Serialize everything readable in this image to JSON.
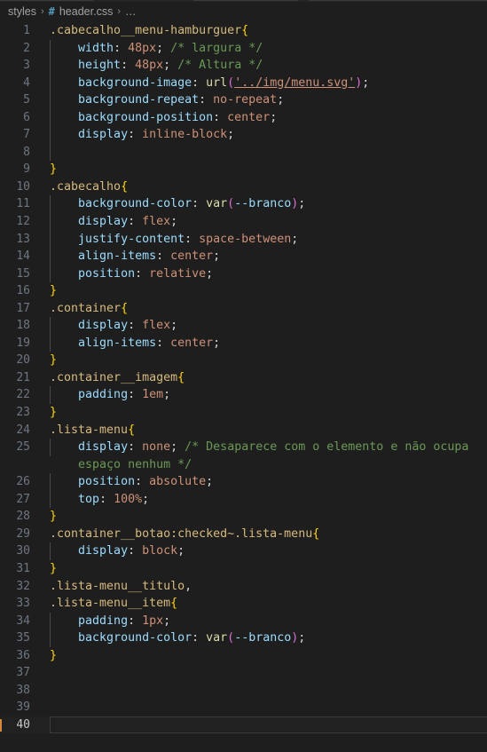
{
  "window": {
    "app": "code-editor",
    "theme": "dark-plus"
  },
  "breadcrumb": {
    "name": "breadcrumb",
    "folder": "styles",
    "separator": "›",
    "file_icon": "#",
    "file": "header.css",
    "ellipsis": "…"
  },
  "editor": {
    "language": "css",
    "total_lines": 40,
    "active_line": 40,
    "indent_size": 4,
    "colors": {
      "background": "#1e1e1e",
      "gutter_text": "#6e7681",
      "active_gutter_text": "#c8c8c8",
      "selector": "#d7ba7d",
      "brace": "#ffd700",
      "property": "#9cdcfe",
      "value": "#ce9178",
      "comment": "#6a9955",
      "function": "#dcdcaa",
      "paren": "#da70d6",
      "punctuation": "#d4d4d4",
      "active_line_border": "#3b3b3b",
      "indent_guide": "#484848",
      "cursor_marker": "#d7883e"
    },
    "lines": [
      {
        "n": 1,
        "indent": 0,
        "guide": false,
        "tokens": [
          {
            "c": "t-sel",
            "t": ".cabecalho__menu-hamburguer"
          },
          {
            "c": "t-brace",
            "t": "{"
          }
        ]
      },
      {
        "n": 2,
        "indent": 1,
        "guide": true,
        "tokens": [
          {
            "c": "t-prop",
            "t": "width"
          },
          {
            "c": "t-punc",
            "t": ": "
          },
          {
            "c": "t-val",
            "t": "48px"
          },
          {
            "c": "t-punc",
            "t": ";"
          },
          {
            "c": "t-punc",
            "t": " "
          },
          {
            "c": "t-com",
            "t": "/* largura */"
          }
        ]
      },
      {
        "n": 3,
        "indent": 1,
        "guide": true,
        "tokens": [
          {
            "c": "t-prop",
            "t": "height"
          },
          {
            "c": "t-punc",
            "t": ": "
          },
          {
            "c": "t-val",
            "t": "48px"
          },
          {
            "c": "t-punc",
            "t": ";"
          },
          {
            "c": "t-punc",
            "t": " "
          },
          {
            "c": "t-com",
            "t": "/* Altura */"
          }
        ]
      },
      {
        "n": 4,
        "indent": 1,
        "guide": true,
        "tokens": [
          {
            "c": "t-prop",
            "t": "background-image"
          },
          {
            "c": "t-punc",
            "t": ": "
          },
          {
            "c": "t-fn",
            "t": "url"
          },
          {
            "c": "t-paren",
            "t": "("
          },
          {
            "c": "t-link",
            "t": "'../img/menu.svg'"
          },
          {
            "c": "t-paren",
            "t": ")"
          },
          {
            "c": "t-punc",
            "t": ";"
          }
        ]
      },
      {
        "n": 5,
        "indent": 1,
        "guide": true,
        "tokens": [
          {
            "c": "t-prop",
            "t": "background-repeat"
          },
          {
            "c": "t-punc",
            "t": ": "
          },
          {
            "c": "t-val",
            "t": "no-repeat"
          },
          {
            "c": "t-punc",
            "t": ";"
          }
        ]
      },
      {
        "n": 6,
        "indent": 1,
        "guide": true,
        "tokens": [
          {
            "c": "t-prop",
            "t": "background-position"
          },
          {
            "c": "t-punc",
            "t": ": "
          },
          {
            "c": "t-val",
            "t": "center"
          },
          {
            "c": "t-punc",
            "t": ";"
          }
        ]
      },
      {
        "n": 7,
        "indent": 1,
        "guide": true,
        "tokens": [
          {
            "c": "t-prop",
            "t": "display"
          },
          {
            "c": "t-punc",
            "t": ": "
          },
          {
            "c": "t-val",
            "t": "inline-block"
          },
          {
            "c": "t-punc",
            "t": ";"
          }
        ]
      },
      {
        "n": 8,
        "indent": 1,
        "guide": true,
        "tokens": []
      },
      {
        "n": 9,
        "indent": 0,
        "guide": false,
        "tokens": [
          {
            "c": "t-brace",
            "t": "}"
          }
        ]
      },
      {
        "n": 10,
        "indent": 0,
        "guide": false,
        "tokens": [
          {
            "c": "t-sel",
            "t": ".cabecalho"
          },
          {
            "c": "t-brace",
            "t": "{"
          }
        ]
      },
      {
        "n": 11,
        "indent": 1,
        "guide": true,
        "tokens": [
          {
            "c": "t-prop",
            "t": "background-color"
          },
          {
            "c": "t-punc",
            "t": ": "
          },
          {
            "c": "t-fn",
            "t": "var"
          },
          {
            "c": "t-paren",
            "t": "("
          },
          {
            "c": "t-var",
            "t": "--branco"
          },
          {
            "c": "t-paren",
            "t": ")"
          },
          {
            "c": "t-punc",
            "t": ";"
          }
        ]
      },
      {
        "n": 12,
        "indent": 1,
        "guide": true,
        "tokens": [
          {
            "c": "t-prop",
            "t": "display"
          },
          {
            "c": "t-punc",
            "t": ": "
          },
          {
            "c": "t-val",
            "t": "flex"
          },
          {
            "c": "t-punc",
            "t": ";"
          }
        ]
      },
      {
        "n": 13,
        "indent": 1,
        "guide": true,
        "tokens": [
          {
            "c": "t-prop",
            "t": "justify-content"
          },
          {
            "c": "t-punc",
            "t": ": "
          },
          {
            "c": "t-val",
            "t": "space-between"
          },
          {
            "c": "t-punc",
            "t": ";"
          }
        ]
      },
      {
        "n": 14,
        "indent": 1,
        "guide": true,
        "tokens": [
          {
            "c": "t-prop",
            "t": "align-items"
          },
          {
            "c": "t-punc",
            "t": ": "
          },
          {
            "c": "t-val",
            "t": "center"
          },
          {
            "c": "t-punc",
            "t": ";"
          }
        ]
      },
      {
        "n": 15,
        "indent": 1,
        "guide": true,
        "tokens": [
          {
            "c": "t-prop",
            "t": "position"
          },
          {
            "c": "t-punc",
            "t": ": "
          },
          {
            "c": "t-val",
            "t": "relative"
          },
          {
            "c": "t-punc",
            "t": ";"
          }
        ]
      },
      {
        "n": 16,
        "indent": 0,
        "guide": false,
        "tokens": [
          {
            "c": "t-brace",
            "t": "}"
          }
        ]
      },
      {
        "n": 17,
        "indent": 0,
        "guide": false,
        "tokens": [
          {
            "c": "t-sel",
            "t": ".container"
          },
          {
            "c": "t-brace",
            "t": "{"
          }
        ]
      },
      {
        "n": 18,
        "indent": 1,
        "guide": true,
        "tokens": [
          {
            "c": "t-prop",
            "t": "display"
          },
          {
            "c": "t-punc",
            "t": ": "
          },
          {
            "c": "t-val",
            "t": "flex"
          },
          {
            "c": "t-punc",
            "t": ";"
          }
        ]
      },
      {
        "n": 19,
        "indent": 1,
        "guide": true,
        "tokens": [
          {
            "c": "t-prop",
            "t": "align-items"
          },
          {
            "c": "t-punc",
            "t": ": "
          },
          {
            "c": "t-val",
            "t": "center"
          },
          {
            "c": "t-punc",
            "t": ";"
          }
        ]
      },
      {
        "n": 20,
        "indent": 0,
        "guide": false,
        "tokens": [
          {
            "c": "t-brace",
            "t": "}"
          }
        ]
      },
      {
        "n": 21,
        "indent": 0,
        "guide": false,
        "tokens": [
          {
            "c": "t-sel",
            "t": ".container__imagem"
          },
          {
            "c": "t-brace",
            "t": "{"
          }
        ]
      },
      {
        "n": 22,
        "indent": 1,
        "guide": true,
        "tokens": [
          {
            "c": "t-prop",
            "t": "padding"
          },
          {
            "c": "t-punc",
            "t": ": "
          },
          {
            "c": "t-val",
            "t": "1em"
          },
          {
            "c": "t-punc",
            "t": ";"
          }
        ]
      },
      {
        "n": 23,
        "indent": 0,
        "guide": false,
        "tokens": [
          {
            "c": "t-brace",
            "t": "}"
          }
        ]
      },
      {
        "n": 24,
        "indent": 0,
        "guide": false,
        "tokens": [
          {
            "c": "t-sel",
            "t": ".lista-menu"
          },
          {
            "c": "t-brace",
            "t": "{"
          }
        ]
      },
      {
        "n": 25,
        "indent": 1,
        "guide": true,
        "tokens": [
          {
            "c": "t-prop",
            "t": "display"
          },
          {
            "c": "t-punc",
            "t": ": "
          },
          {
            "c": "t-val",
            "t": "none"
          },
          {
            "c": "t-punc",
            "t": ";"
          },
          {
            "c": "t-punc",
            "t": " "
          },
          {
            "c": "t-com",
            "t": "/* Desaparece com o elemento e não ocupa"
          }
        ]
      },
      {
        "n": "",
        "indent": 1,
        "guide": false,
        "wrap": true,
        "tokens": [
          {
            "c": "t-com",
            "t": "espaço nenhum */"
          }
        ]
      },
      {
        "n": 26,
        "indent": 1,
        "guide": true,
        "tokens": [
          {
            "c": "t-prop",
            "t": "position"
          },
          {
            "c": "t-punc",
            "t": ": "
          },
          {
            "c": "t-val",
            "t": "absolute"
          },
          {
            "c": "t-punc",
            "t": ";"
          }
        ]
      },
      {
        "n": 27,
        "indent": 1,
        "guide": true,
        "tokens": [
          {
            "c": "t-prop",
            "t": "top"
          },
          {
            "c": "t-punc",
            "t": ": "
          },
          {
            "c": "t-val",
            "t": "100%"
          },
          {
            "c": "t-punc",
            "t": ";"
          }
        ]
      },
      {
        "n": 28,
        "indent": 0,
        "guide": false,
        "tokens": [
          {
            "c": "t-brace",
            "t": "}"
          }
        ]
      },
      {
        "n": 29,
        "indent": 0,
        "guide": false,
        "tokens": [
          {
            "c": "t-sel",
            "t": ".container__botao:checked~.lista-menu"
          },
          {
            "c": "t-brace",
            "t": "{"
          }
        ]
      },
      {
        "n": 30,
        "indent": 1,
        "guide": true,
        "tokens": [
          {
            "c": "t-prop",
            "t": "display"
          },
          {
            "c": "t-punc",
            "t": ": "
          },
          {
            "c": "t-val",
            "t": "block"
          },
          {
            "c": "t-punc",
            "t": ";"
          }
        ]
      },
      {
        "n": 31,
        "indent": 0,
        "guide": false,
        "tokens": [
          {
            "c": "t-brace",
            "t": "}"
          }
        ]
      },
      {
        "n": 32,
        "indent": 0,
        "guide": false,
        "tokens": [
          {
            "c": "t-sel",
            "t": ".lista-menu__titulo"
          },
          {
            "c": "t-punc",
            "t": ","
          }
        ]
      },
      {
        "n": 33,
        "indent": 0,
        "guide": false,
        "tokens": [
          {
            "c": "t-sel",
            "t": ".lista-menu__item"
          },
          {
            "c": "t-brace",
            "t": "{"
          }
        ]
      },
      {
        "n": 34,
        "indent": 1,
        "guide": true,
        "tokens": [
          {
            "c": "t-prop",
            "t": "padding"
          },
          {
            "c": "t-punc",
            "t": ": "
          },
          {
            "c": "t-val",
            "t": "1px"
          },
          {
            "c": "t-punc",
            "t": ";"
          }
        ]
      },
      {
        "n": 35,
        "indent": 1,
        "guide": true,
        "tokens": [
          {
            "c": "t-prop",
            "t": "background-color"
          },
          {
            "c": "t-punc",
            "t": ": "
          },
          {
            "c": "t-fn",
            "t": "var"
          },
          {
            "c": "t-paren",
            "t": "("
          },
          {
            "c": "t-var",
            "t": "--branco"
          },
          {
            "c": "t-paren",
            "t": ")"
          },
          {
            "c": "t-punc",
            "t": ";"
          }
        ]
      },
      {
        "n": 36,
        "indent": 0,
        "guide": false,
        "tokens": [
          {
            "c": "t-brace",
            "t": "}"
          }
        ]
      },
      {
        "n": 37,
        "indent": 0,
        "guide": false,
        "tokens": []
      },
      {
        "n": 38,
        "indent": 0,
        "guide": false,
        "tokens": []
      },
      {
        "n": 39,
        "indent": 0,
        "guide": false,
        "tokens": []
      },
      {
        "n": 40,
        "indent": 0,
        "guide": false,
        "active": true,
        "tokens": []
      }
    ]
  }
}
